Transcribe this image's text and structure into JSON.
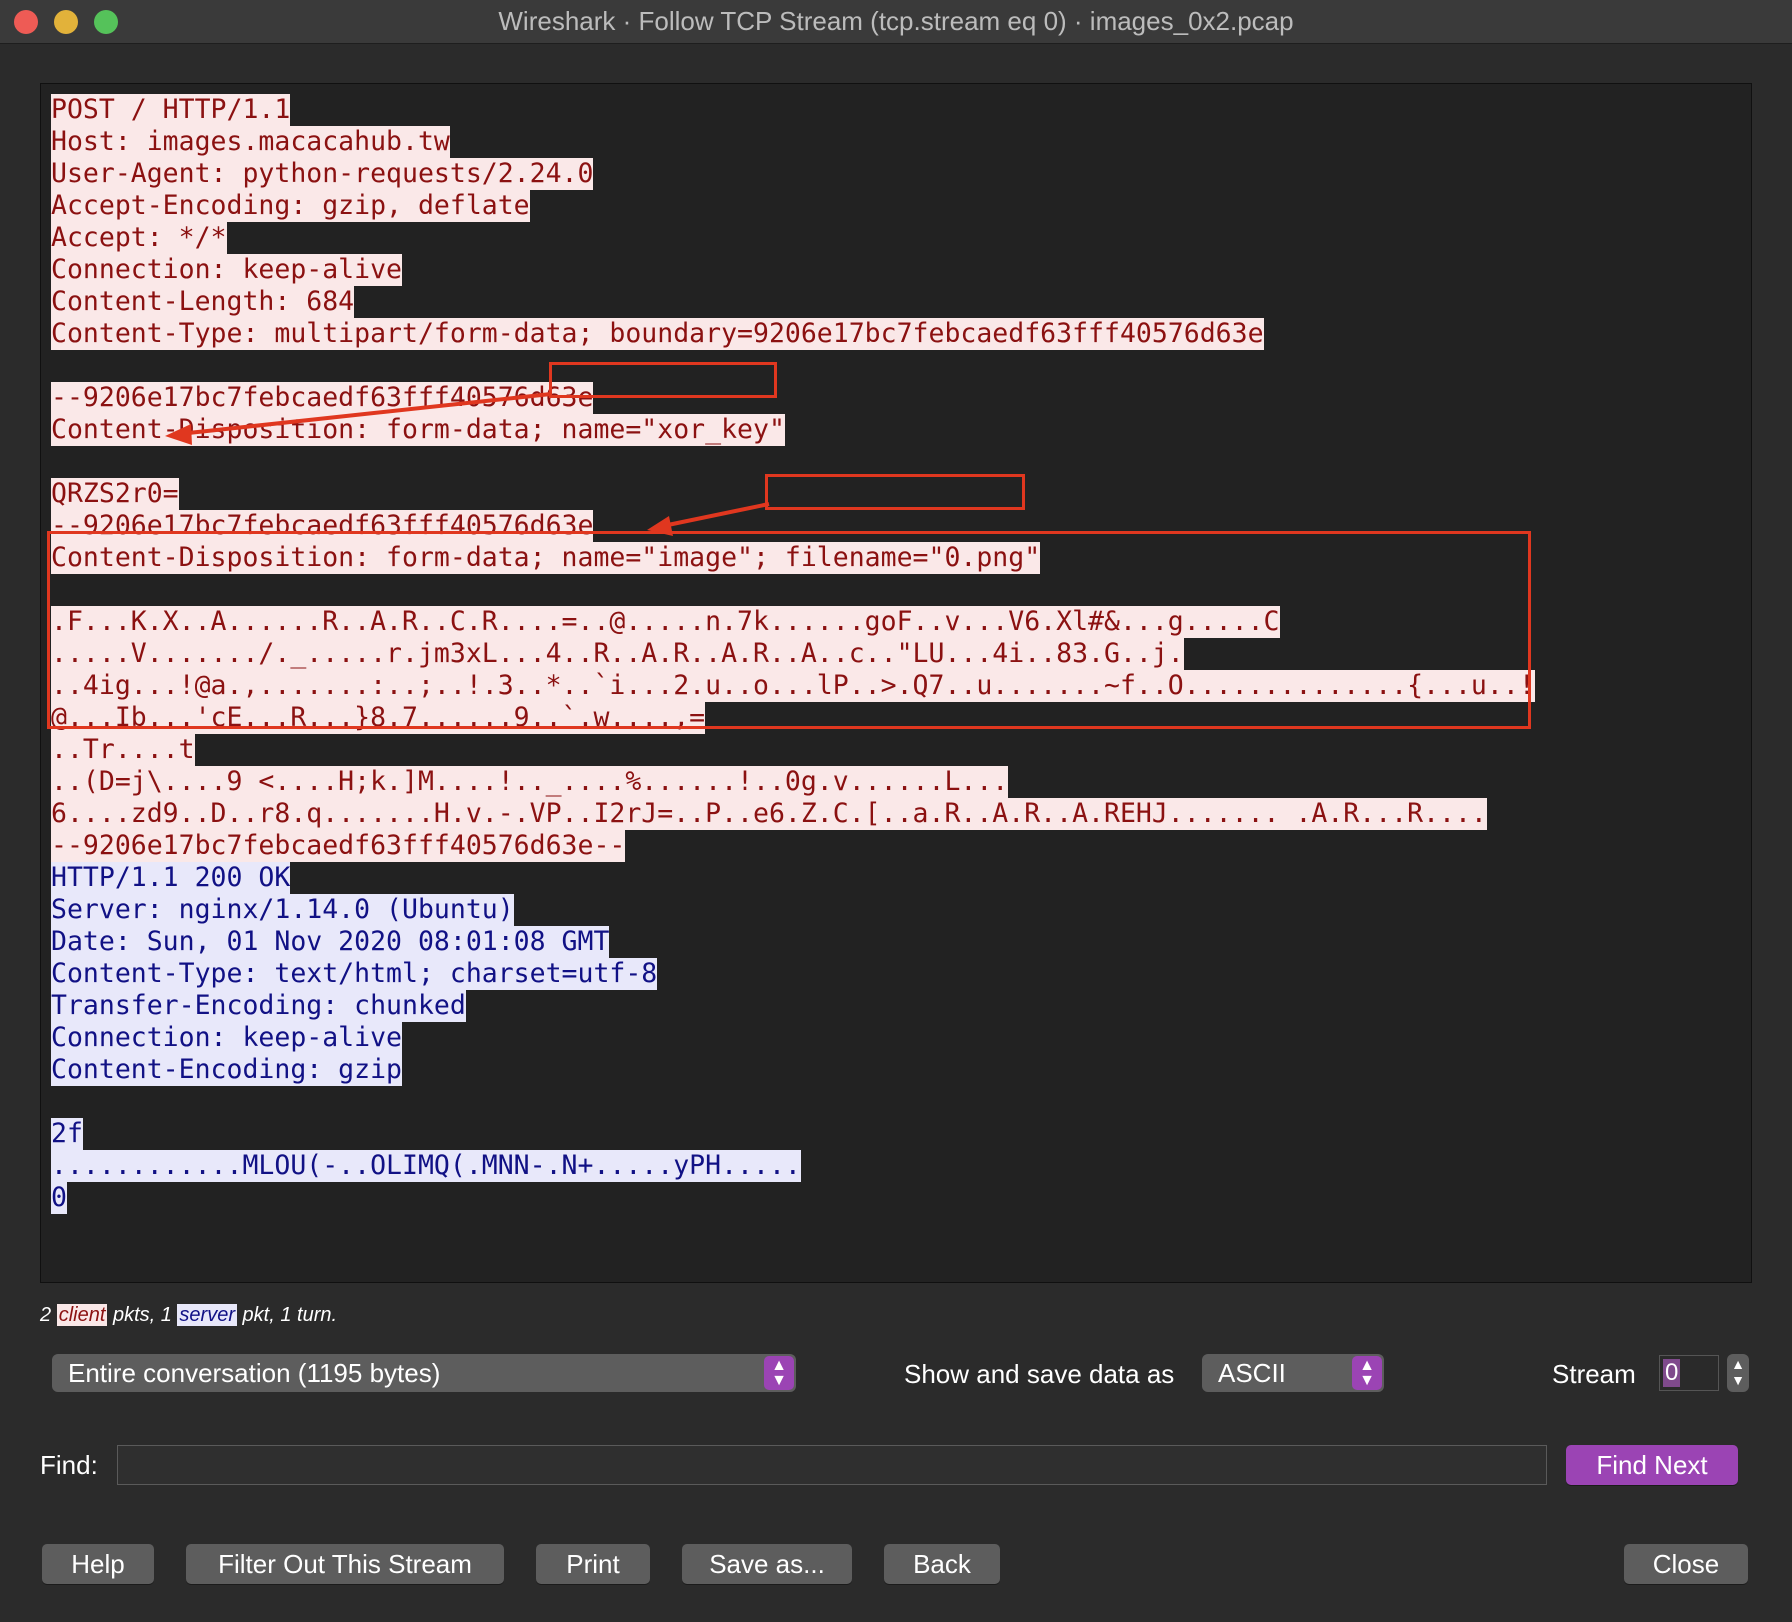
{
  "window": {
    "title": "Wireshark · Follow TCP Stream (tcp.stream eq 0) · images_0x2.pcap"
  },
  "stream": {
    "lines": [
      {
        "text": "POST / HTTP/1.1",
        "dir": "client"
      },
      {
        "text": "Host: images.macacahub.tw",
        "dir": "client"
      },
      {
        "text": "User-Agent: python-requests/2.24.0",
        "dir": "client"
      },
      {
        "text": "Accept-Encoding: gzip, deflate",
        "dir": "client"
      },
      {
        "text": "Accept: */*",
        "dir": "client"
      },
      {
        "text": "Connection: keep-alive",
        "dir": "client"
      },
      {
        "text": "Content-Length: 684",
        "dir": "client"
      },
      {
        "text": "Content-Type: multipart/form-data; boundary=9206e17bc7febcaedf63fff40576d63e",
        "dir": "client"
      },
      {
        "text": "",
        "dir": "client"
      },
      {
        "text": "--9206e17bc7febcaedf63fff40576d63e",
        "dir": "client"
      },
      {
        "text": "Content-Disposition: form-data; name=\"xor_key\"",
        "dir": "client"
      },
      {
        "text": "",
        "dir": "client"
      },
      {
        "text": "QRZS2r0=",
        "dir": "client"
      },
      {
        "text": "--9206e17bc7febcaedf63fff40576d63e",
        "dir": "client"
      },
      {
        "text": "Content-Disposition: form-data; name=\"image\"; filename=\"0.png\"",
        "dir": "client"
      },
      {
        "text": "",
        "dir": "client"
      },
      {
        "text": ".F...K.X..A......R..A.R..C.R....=..@.....n.7k......goF..v...V6.Xl#&...g.....C",
        "dir": "client"
      },
      {
        "text": ".....V......./._.....r.jm3xL...4..R..A.R..A.R..A..c..\"LU...4i..83.G..j.",
        "dir": "client"
      },
      {
        "text": "..4ig...!@a.,.......:..;..!.3..*..`i...2.u..o...lP..>.Q7..u.......~f..O..............{...u..!",
        "dir": "client"
      },
      {
        "text": "@...Ib...'cE...R...}8.7......9..`.w....,=",
        "dir": "client"
      },
      {
        "text": "..Tr....t",
        "dir": "client"
      },
      {
        "text": "..(D=j\\....9 <....H;k.]M....!.._....%......!..0g.v......L...",
        "dir": "client"
      },
      {
        "text": "6....zd9..D..r8.q.......H.v.-.VP..I2rJ=..P..e6.Z.C.[..a.R..A.R..A.REHJ....... .A.R...R....",
        "dir": "client"
      },
      {
        "text": "--9206e17bc7febcaedf63fff40576d63e--",
        "dir": "client"
      },
      {
        "text": "HTTP/1.1 200 OK",
        "dir": "server"
      },
      {
        "text": "Server: nginx/1.14.0 (Ubuntu)",
        "dir": "server"
      },
      {
        "text": "Date: Sun, 01 Nov 2020 08:01:08 GMT",
        "dir": "server"
      },
      {
        "text": "Content-Type: text/html; charset=utf-8",
        "dir": "server"
      },
      {
        "text": "Transfer-Encoding: chunked",
        "dir": "server"
      },
      {
        "text": "Connection: keep-alive",
        "dir": "server"
      },
      {
        "text": "Content-Encoding: gzip",
        "dir": "server"
      },
      {
        "text": "",
        "dir": "server"
      },
      {
        "text": "2f",
        "dir": "server"
      },
      {
        "text": "............MLOU(-..OLIMQ(.MNN-.N+.....yPH.....",
        "dir": "server"
      },
      {
        "text": "0",
        "dir": "server"
      }
    ]
  },
  "stats": {
    "pre": "2 ",
    "client": "client",
    "mid": " pkts, 1 ",
    "server": "server",
    "post": " pkt, 1 turn."
  },
  "controls": {
    "conversation": "Entire conversation (1195 bytes)",
    "show_as_label": "Show and save data as",
    "show_as_value": "ASCII",
    "stream_label": "Stream",
    "stream_value": "0",
    "find_label": "Find:",
    "find_value": "",
    "find_next": "Find Next"
  },
  "buttons": {
    "help": "Help",
    "filter_out": "Filter Out This Stream",
    "print": "Print",
    "save_as": "Save as...",
    "back": "Back",
    "close": "Close"
  },
  "colors": {
    "client_bg": "#fae8e8",
    "client_fg": "#8b1111",
    "server_bg": "#e8e8fa",
    "server_fg": "#111185",
    "annotation": "#e0371f",
    "accent": "#9b44b4"
  }
}
